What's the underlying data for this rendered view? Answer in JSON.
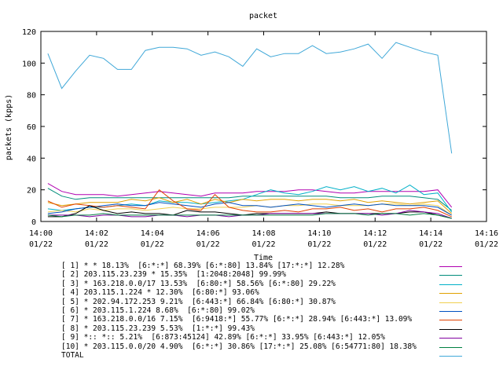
{
  "chart_data": {
    "type": "line",
    "title": "packet",
    "xlabel": "Time",
    "ylabel": "packets (kpps)",
    "ylim": [
      0,
      120
    ],
    "yticks": [
      0,
      20,
      40,
      60,
      80,
      100,
      120
    ],
    "xlim": [
      "01/22 14:00",
      "01/22 14:16"
    ],
    "xticks": [
      {
        "time": "14:00",
        "date": "01/22"
      },
      {
        "time": "14:02",
        "date": "01/22"
      },
      {
        "time": "14:04",
        "date": "01/22"
      },
      {
        "time": "14:06",
        "date": "01/22"
      },
      {
        "time": "14:08",
        "date": "01/22"
      },
      {
        "time": "14:10",
        "date": "01/22"
      },
      {
        "time": "14:12",
        "date": "01/22"
      },
      {
        "time": "14:14",
        "date": "01/22"
      },
      {
        "time": "14:16",
        "date": "01/22"
      }
    ],
    "x": [
      "14:00:15",
      "14:00:45",
      "14:01:15",
      "14:01:45",
      "14:02:15",
      "14:02:45",
      "14:03:15",
      "14:03:45",
      "14:04:15",
      "14:04:45",
      "14:05:15",
      "14:05:45",
      "14:06:15",
      "14:06:45",
      "14:07:15",
      "14:07:45",
      "14:08:15",
      "14:08:45",
      "14:09:15",
      "14:09:45",
      "14:10:15",
      "14:10:45",
      "14:11:15",
      "14:11:45",
      "14:12:15",
      "14:12:45",
      "14:13:15",
      "14:13:45",
      "14:14:15",
      "14:14:45"
    ],
    "series": [
      {
        "name": "[ 1] * * 18.13%  [6:*:*] 68.39% [6:*:80] 13.84% [17:*:*] 12.28%",
        "color": "#b000b0",
        "values": [
          24,
          19,
          17,
          17,
          17,
          16,
          17,
          18,
          19,
          18,
          17,
          16,
          18,
          18,
          18,
          19,
          19,
          19,
          20,
          20,
          19,
          18,
          18,
          19,
          19,
          19,
          19,
          19,
          20,
          9
        ]
      },
      {
        "name": "[ 2] 203.115.23.239 * 15.35%  [1:2048:2048] 99.99%",
        "color": "#008c7a",
        "values": [
          21,
          16,
          14,
          15,
          15,
          15,
          15,
          15,
          15,
          15,
          15,
          15,
          15,
          15,
          16,
          16,
          16,
          16,
          16,
          16,
          16,
          15,
          15,
          15,
          16,
          16,
          16,
          15,
          14,
          7
        ]
      },
      {
        "name": "[ 3] * 163.218.0.0/17 13.53%  [6:80:*] 58.56% [6:*:80] 29.22%",
        "color": "#00b0c8",
        "values": [
          8,
          7,
          8,
          9,
          9,
          10,
          11,
          10,
          13,
          12,
          12,
          11,
          12,
          13,
          14,
          17,
          20,
          18,
          17,
          19,
          22,
          20,
          22,
          19,
          21,
          18,
          23,
          17,
          18,
          6
        ]
      },
      {
        "name": "[ 4] 203.115.1.224 * 12.30%  [6:80:*] 93.06%",
        "color": "#e0a000",
        "values": [
          12,
          10,
          11,
          12,
          12,
          12,
          14,
          13,
          15,
          12,
          14,
          11,
          14,
          12,
          14,
          13,
          14,
          14,
          13,
          14,
          14,
          13,
          14,
          12,
          13,
          12,
          11,
          12,
          13,
          5
        ]
      },
      {
        "name": "[ 5] * 202.94.172.253 9.21%  [6:443:*] 66.84% [6:80:*] 30.87%",
        "color": "#f0d050",
        "values": [
          6,
          7,
          6,
          8,
          7,
          8,
          8,
          7,
          8,
          9,
          8,
          8,
          9,
          9,
          9,
          10,
          9,
          10,
          10,
          11,
          11,
          10,
          10,
          10,
          11,
          11,
          10,
          11,
          10,
          4
        ]
      },
      {
        "name": "[ 6] * 203.115.1.224 8.68%  [6:*:80] 99.02%",
        "color": "#0050c0",
        "values": [
          5,
          6,
          8,
          9,
          10,
          11,
          10,
          10,
          12,
          11,
          10,
          9,
          11,
          12,
          10,
          10,
          9,
          10,
          11,
          10,
          9,
          10,
          11,
          10,
          11,
          10,
          10,
          10,
          9,
          4
        ]
      },
      {
        "name": "[ 7] * 163.218.0.0/16 7.15%  [6:9418:*] 55.77% [6:*:*] 28.94% [6:443:*] 13.09%",
        "color": "#e04000",
        "values": [
          13,
          9,
          11,
          10,
          9,
          10,
          9,
          8,
          20,
          13,
          8,
          7,
          17,
          9,
          7,
          6,
          6,
          7,
          6,
          8,
          8,
          9,
          7,
          8,
          6,
          8,
          8,
          9,
          7,
          3
        ]
      },
      {
        "name": "[ 8] * 203.115.23.239 5.53%  [1:*:*] 99.43%",
        "color": "#000000",
        "values": [
          3,
          3,
          5,
          10,
          7,
          5,
          6,
          5,
          5,
          4,
          7,
          6,
          6,
          5,
          4,
          5,
          5,
          5,
          5,
          5,
          6,
          5,
          5,
          5,
          5,
          5,
          6,
          6,
          4,
          2
        ]
      },
      {
        "name": "[ 9] *:: *:: 5.21%  [6:873:45124] 42.89% [6:*:*] 33.95% [6:443:*] 12.05%",
        "color": "#8000a0",
        "values": [
          4,
          4,
          4,
          3,
          4,
          4,
          3,
          3,
          4,
          4,
          3,
          4,
          4,
          3,
          4,
          4,
          5,
          5,
          5,
          5,
          5,
          5,
          5,
          5,
          4,
          5,
          7,
          6,
          5,
          2
        ]
      },
      {
        "name": "[10] * 203.115.0.0/20 4.90%  [6:*:*] 30.86% [17:*:*] 25.08% [6:54771:80] 18.38%",
        "color": "#008040",
        "values": [
          4,
          3,
          4,
          4,
          5,
          4,
          4,
          4,
          4,
          4,
          4,
          4,
          4,
          4,
          4,
          4,
          4,
          4,
          4,
          4,
          5,
          5,
          5,
          4,
          5,
          5,
          4,
          5,
          4,
          2
        ]
      },
      {
        "name": "TOTAL",
        "color": "#40a8d8",
        "values": [
          106,
          84,
          95,
          105,
          103,
          96,
          96,
          108,
          110,
          110,
          109,
          105,
          107,
          104,
          98,
          109,
          104,
          106,
          106,
          111,
          106,
          107,
          109,
          112,
          103,
          113,
          110,
          107,
          105,
          43
        ]
      }
    ]
  }
}
